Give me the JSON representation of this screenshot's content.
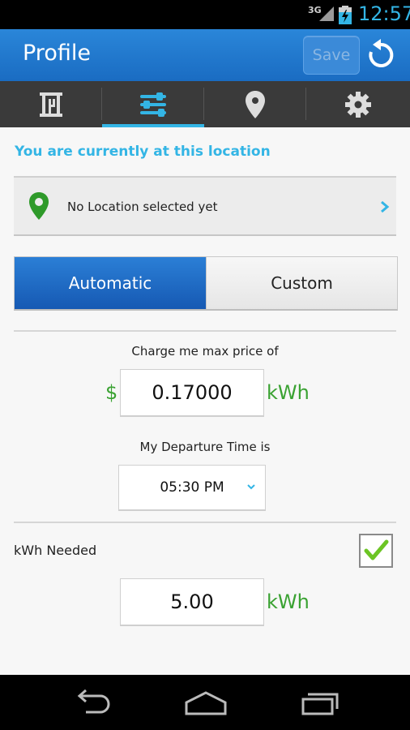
{
  "status_bar": {
    "network": "3G",
    "time": "12:57"
  },
  "action_bar": {
    "title": "Profile",
    "save_label": "Save"
  },
  "tabs": [
    {
      "name": "building-icon",
      "active": false
    },
    {
      "name": "sliders-icon",
      "active": true
    },
    {
      "name": "location-pin-icon",
      "active": false
    },
    {
      "name": "gear-icon",
      "active": false
    }
  ],
  "location": {
    "heading": "You are currently at this location",
    "value": "No Location selected yet"
  },
  "mode": {
    "automatic_label": "Automatic",
    "custom_label": "Custom",
    "selected": "Automatic"
  },
  "price": {
    "label": "Charge me max price of",
    "currency": "$",
    "value": "0.17000",
    "unit": "kWh"
  },
  "departure": {
    "label": "My Departure Time is",
    "value": "05:30 PM"
  },
  "kwh_needed": {
    "label": "kWh Needed",
    "checked": true,
    "value": "5.00",
    "unit": "kWh"
  },
  "colors": {
    "accent": "#33b5e5",
    "action_bar": "#1f78cf",
    "green": "#3aa232"
  }
}
